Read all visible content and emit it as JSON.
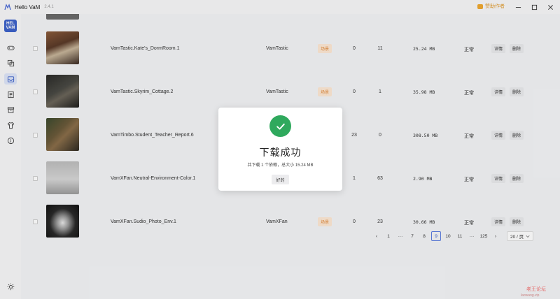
{
  "app": {
    "title": "Hello VaM",
    "version": "2.4.1",
    "sponsor_label": "赞助作者",
    "logo_text": "HEL VAM"
  },
  "rows": [
    {
      "name": "VamTastic.Kate's_DormRoom.1",
      "creator": "VamTastic",
      "tag": "场景",
      "c1": "0",
      "c2": "11",
      "size": "25.24 MB",
      "status": "正常",
      "detail": "详情",
      "delete": "删除"
    },
    {
      "name": "VamTastic.Skyrim_Cottage.2",
      "creator": "VamTastic",
      "tag": "场景",
      "c1": "0",
      "c2": "1",
      "size": "35.98 MB",
      "status": "正常",
      "detail": "详情",
      "delete": "删除"
    },
    {
      "name": "VamTimbo.Student_Teacher_Report.6",
      "creator": "",
      "tag": "",
      "c1": "23",
      "c2": "0",
      "size": "308.50 MB",
      "status": "正常",
      "detail": "详情",
      "delete": "删除"
    },
    {
      "name": "VamXFan.Neutral-Environment-Color.1",
      "creator": "",
      "tag": "",
      "c1": "1",
      "c2": "63",
      "size": "2.90 MB",
      "status": "正常",
      "detail": "详情",
      "delete": "删除"
    },
    {
      "name": "VamXFan.Sudio_Photo_Env.1",
      "creator": "VamXFan",
      "tag": "场景",
      "c1": "0",
      "c2": "23",
      "size": "30.66 MB",
      "status": "正常",
      "detail": "详情",
      "delete": "删除"
    }
  ],
  "pagination": {
    "prev": "‹",
    "next": "›",
    "pages": [
      "1",
      "···",
      "7",
      "8",
      "9",
      "10",
      "11",
      "···",
      "125"
    ],
    "current": "9",
    "page_size": "20 / 页"
  },
  "dialog": {
    "title": "下载成功",
    "message": "共下载 1 个依赖，总大小 15.24 MB",
    "ok_label": "好的"
  },
  "watermark": {
    "text": "老王论坛",
    "sub": "laowang.vip"
  },
  "colors": {
    "accent": "#3d62c9",
    "success": "#2fa95d",
    "tag_bg": "#fde8d4",
    "tag_text": "#e08a3c"
  }
}
